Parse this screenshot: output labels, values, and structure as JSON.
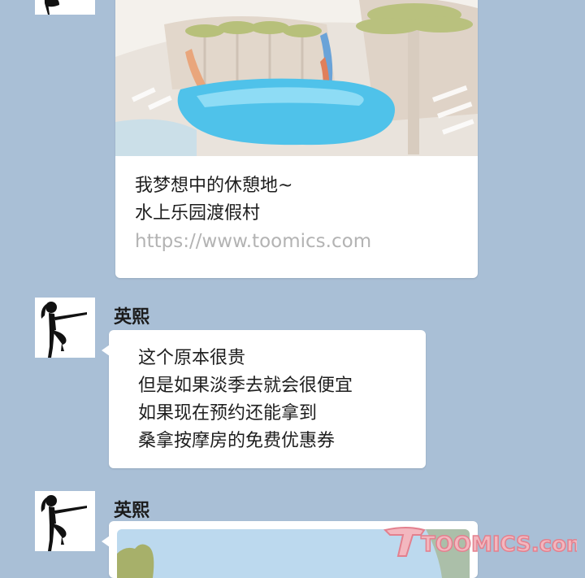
{
  "messages": [
    {
      "type": "link-preview",
      "text_lines": [
        "我梦想中的休憩地~",
        "水上乐园渡假村"
      ],
      "url": "https://www.toomics.com"
    },
    {
      "type": "text",
      "sender": "英熙",
      "text_lines": [
        "这个原本很贵",
        "但是如果淡季去就会很便宜",
        "如果现在预约还能拿到",
        "桑拿按摩房的免费优惠券"
      ]
    },
    {
      "type": "image",
      "sender": "英熙"
    }
  ],
  "watermark": {
    "text": "TOOMICS.com"
  },
  "colors": {
    "background": "#a9bfd6",
    "bubble": "#ffffff",
    "url_text": "#b3b3b3",
    "watermark": "#e3808e"
  }
}
